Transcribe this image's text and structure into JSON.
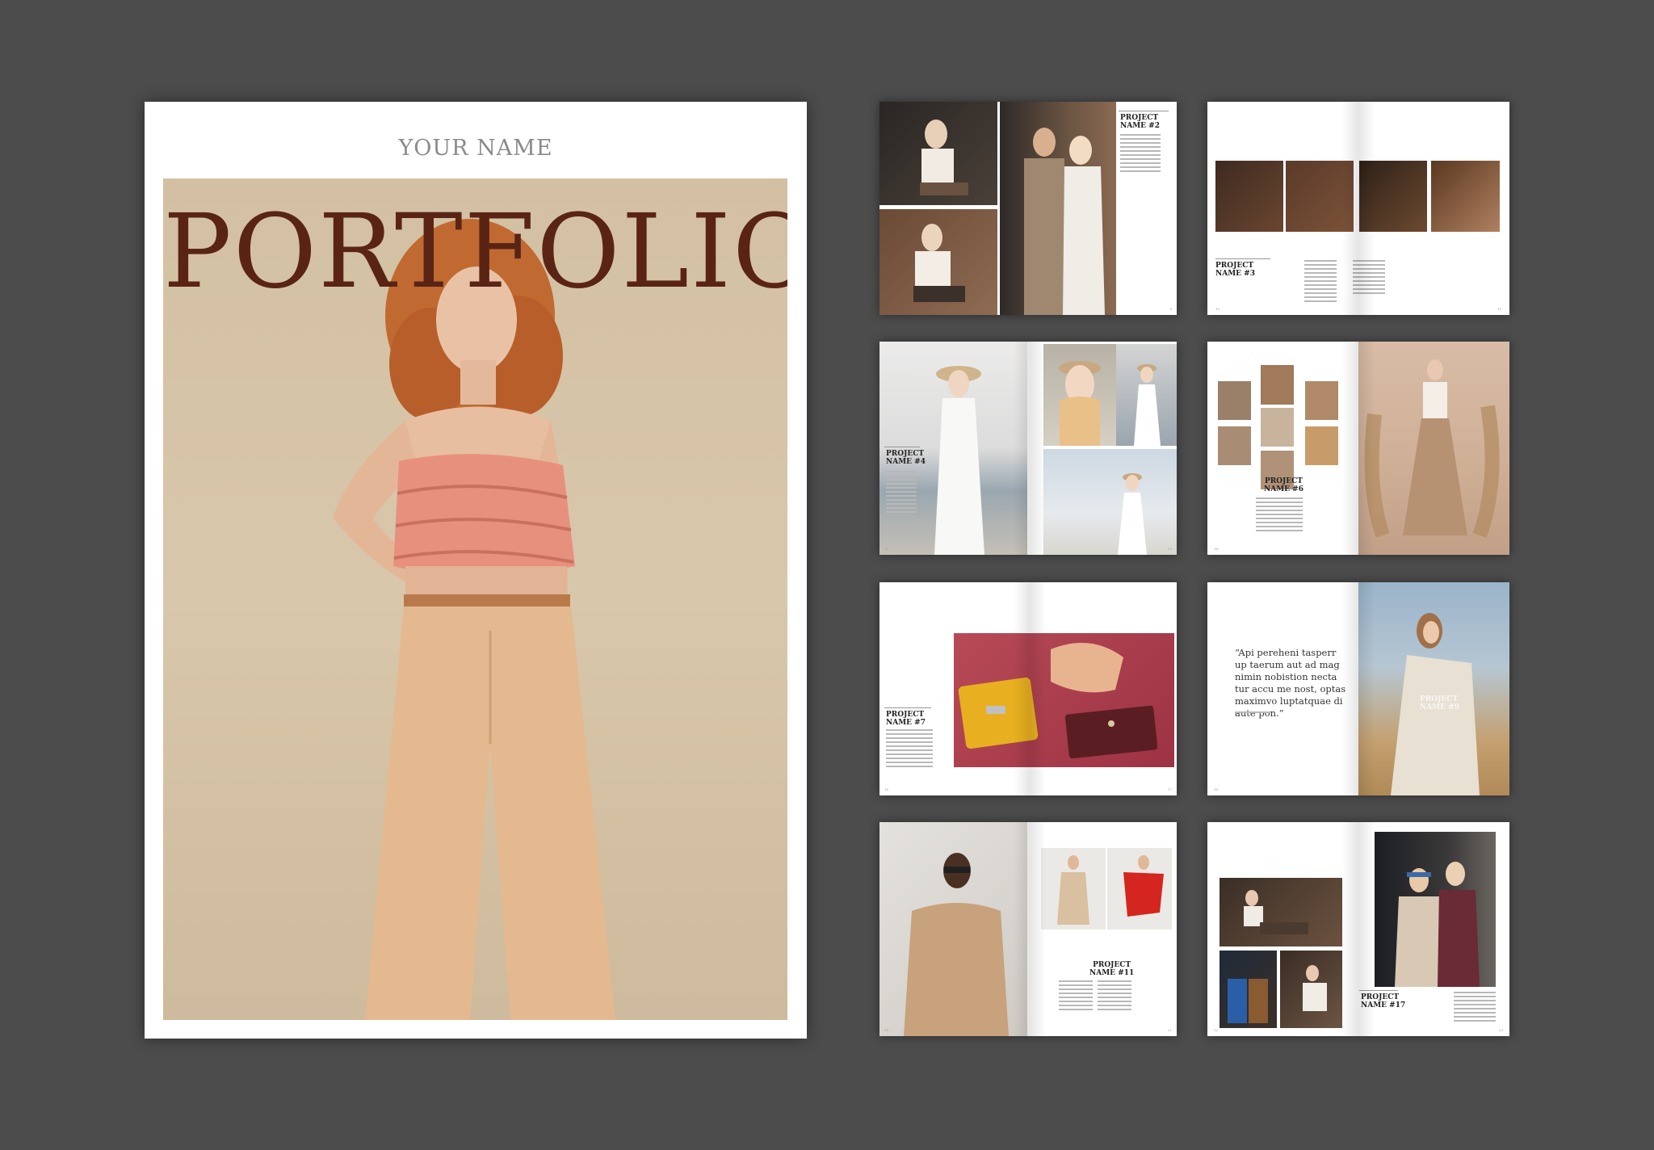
{
  "cover": {
    "name": "YOUR NAME",
    "title": "PORTFOLIO",
    "colors": {
      "title": "#5a2414",
      "name": "#8a8a8a",
      "background": "#4c4c4c"
    }
  },
  "spreads": [
    {
      "project": "PROJECT\nNAME #2",
      "page_left": "",
      "page_right": "9"
    },
    {
      "project": "PROJECT\nNAME #3",
      "page_left": "10",
      "page_right": "11"
    },
    {
      "project": "PROJECT\nNAME #4",
      "page_left": "12",
      "page_right": "13"
    },
    {
      "project": "PROJECT\nNAME #6",
      "page_left": "14",
      "page_right": "15"
    },
    {
      "project": "PROJECT\nNAME #7",
      "page_left": "16",
      "page_right": "17"
    },
    {
      "project": "PROJECT\nNAME #9",
      "page_left": "18",
      "page_right": "19",
      "quote": "“Api pereheni tasperr\nup taerum aut ad mag\nnimin nobistion necta\ntur accu me nost, optas\nmaximvo luptatquae di\naute pon.”"
    },
    {
      "project": "PROJECT\nNAME #11",
      "page_left": "20",
      "page_right": "21"
    },
    {
      "project": "PROJECT\nNAME #17",
      "page_left": "22",
      "page_right": "23"
    }
  ]
}
